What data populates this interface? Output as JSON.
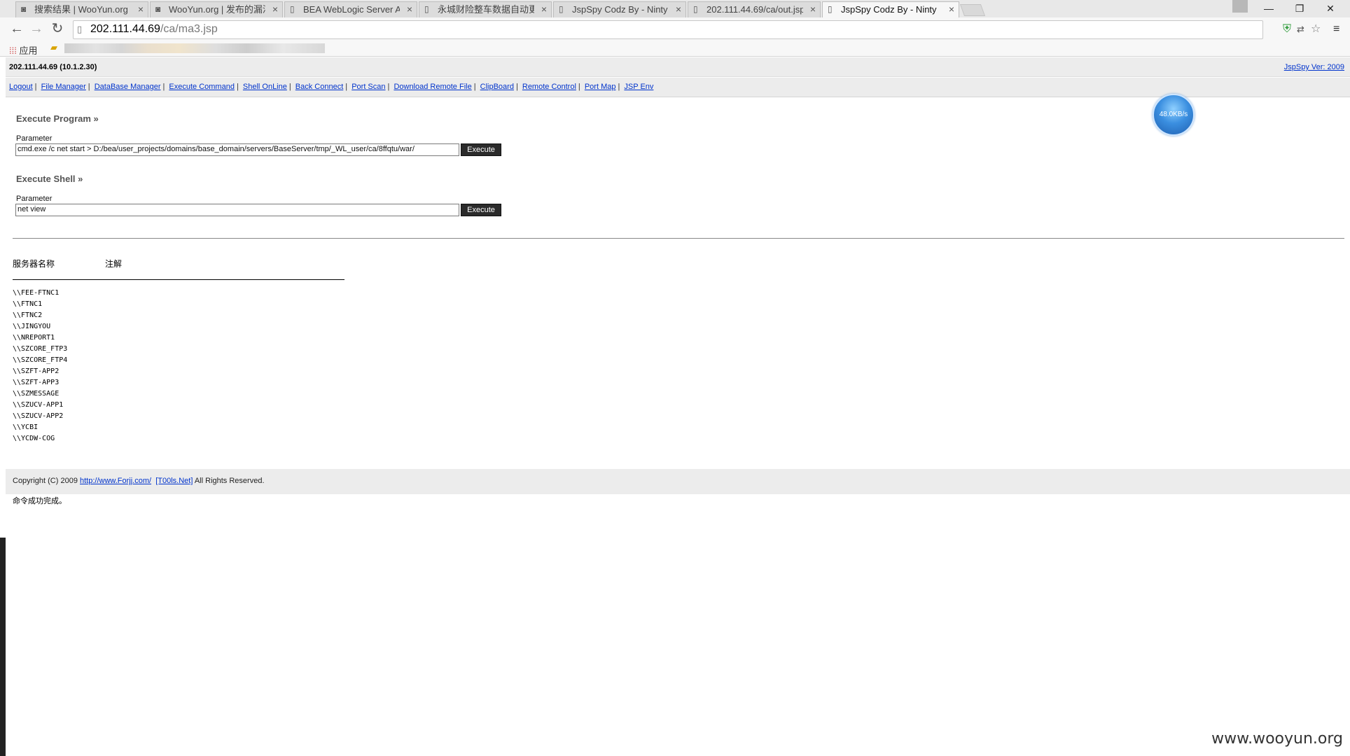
{
  "browser": {
    "tabs": [
      {
        "label": "搜索结果 | WooYun.org",
        "icon": "wooyun-favicon",
        "active": false
      },
      {
        "label": "WooYun.org | 发布的漏洞",
        "icon": "wooyun-favicon",
        "active": false
      },
      {
        "label": "BEA WebLogic Server Ad",
        "icon": "page-icon",
        "active": false
      },
      {
        "label": "永城财险整车数据自动更新",
        "icon": "page-icon",
        "active": false
      },
      {
        "label": "JspSpy Codz By - Ninty",
        "icon": "page-icon",
        "active": false
      },
      {
        "label": "202.111.44.69/ca/out.jsp",
        "icon": "page-icon",
        "active": false
      },
      {
        "label": "JspSpy Codz By - Ninty",
        "icon": "page-icon",
        "active": true
      }
    ],
    "url_host": "202.111.44.69",
    "url_path": "/ca/ma3.jsp",
    "bookmarks_apps_label": "应用"
  },
  "page": {
    "server_ip": "202.111.44.69 (10.1.2.30)",
    "version_link": "JspSpy Ver: 2009",
    "nav_links": [
      "Logout",
      "File Manager",
      "DataBase Manager",
      "Execute Command",
      "Shell OnLine",
      "Back Connect",
      "Port Scan",
      "Download Remote File",
      "ClipBoard",
      "Remote Control",
      "Port Map",
      "JSP Env"
    ],
    "execute_program": {
      "title": "Execute Program »",
      "param_label": "Parameter",
      "value": "cmd.exe /c net start > D:/bea/user_projects/domains/base_domain/servers/BaseServer/tmp/_WL_user/ca/8ffqtu/war/",
      "button": "Execute"
    },
    "execute_shell": {
      "title": "Execute Shell »",
      "param_label": "Parameter",
      "value": "net view",
      "button": "Execute"
    },
    "output": {
      "col_server_name": "服务器名称",
      "col_comment": "注解",
      "servers": [
        "\\\\FEE-FTNC1",
        "\\\\FTNC1",
        "\\\\FTNC2",
        "\\\\JINGYOU",
        "\\\\NREPORT1",
        "\\\\SZCORE_FTP3",
        "\\\\SZCORE_FTP4",
        "\\\\SZFT-APP2",
        "\\\\SZFT-APP3",
        "\\\\SZMESSAGE",
        "\\\\SZUCV-APP1",
        "\\\\SZUCV-APP2",
        "\\\\YCBI",
        "\\\\YCDW-COG"
      ],
      "result": "命令成功完成。"
    },
    "footer": {
      "prefix": "Copyright (C) 2009",
      "link1": "http://www.Forjj.com/",
      "link2": "[T00ls.Net]",
      "suffix": "All Rights Reserved."
    },
    "speed_widget": "48.0KB/s",
    "watermark": "www.wooyun.org"
  }
}
